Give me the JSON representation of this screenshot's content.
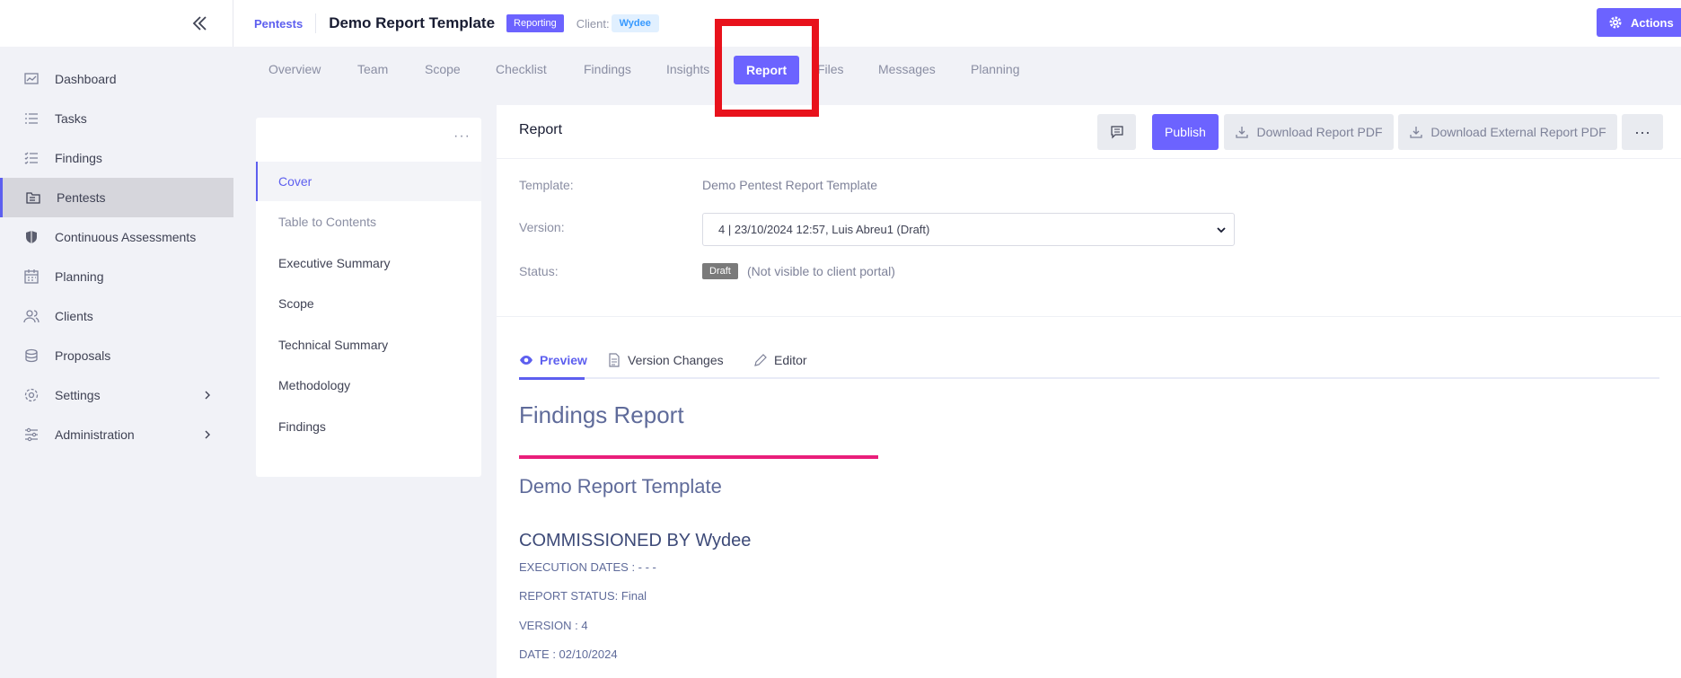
{
  "sidebar": {
    "items": [
      {
        "label": "Dashboard",
        "icon": "chart-icon"
      },
      {
        "label": "Tasks",
        "icon": "list-icon"
      },
      {
        "label": "Findings",
        "icon": "checklist-icon"
      },
      {
        "label": "Pentests",
        "icon": "folder-icon",
        "active": true
      },
      {
        "label": "Continuous Assessments",
        "icon": "shield-icon"
      },
      {
        "label": "Planning",
        "icon": "calendar-icon"
      },
      {
        "label": "Clients",
        "icon": "users-icon"
      },
      {
        "label": "Proposals",
        "icon": "stack-icon"
      },
      {
        "label": "Settings",
        "icon": "gear-icon",
        "has_children": true
      },
      {
        "label": "Administration",
        "icon": "sliders-icon",
        "has_children": true
      }
    ]
  },
  "header": {
    "breadcrumb": "Pentests",
    "title": "Demo Report Template",
    "status_badge": "Reporting",
    "client_label": "Client:",
    "client_name": "Wydee",
    "actions_label": "Actions"
  },
  "tabs": [
    "Overview",
    "Team",
    "Scope",
    "Checklist",
    "Findings",
    "Insights",
    "Report",
    "Files",
    "Messages",
    "Planning"
  ],
  "active_tab": "Report",
  "toc": {
    "items": [
      "Cover",
      "Table to Contents",
      "Executive Summary",
      "Scope",
      "Technical Summary",
      "Methodology",
      "Findings"
    ],
    "active": "Cover"
  },
  "report": {
    "title": "Report",
    "publish_label": "Publish",
    "download_pdf_label": "Download Report PDF",
    "download_external_label": "Download External Report PDF",
    "template_label": "Template:",
    "template_value": "Demo Pentest Report Template",
    "version_label": "Version:",
    "version_value": "4 | 23/10/2024 12:57, Luis Abreu1 (Draft)",
    "status_label": "Status:",
    "status_badge": "Draft",
    "status_note": "(Not visible to client portal)",
    "subtabs": [
      "Preview",
      "Version Changes",
      "Editor"
    ],
    "active_subtab": "Preview"
  },
  "preview": {
    "heading": "Findings Report",
    "subheading": "Demo Report Template",
    "commissioned": "COMMISSIONED BY Wydee",
    "execution_dates": "EXECUTION DATES : - - -",
    "report_status": "REPORT STATUS: Final",
    "version": "VERSION : 4",
    "date": "DATE : 02/10/2024"
  },
  "colors": {
    "accent": "#6c63ff",
    "highlight": "#e8121c",
    "pink_rule": "#e91e7a"
  }
}
